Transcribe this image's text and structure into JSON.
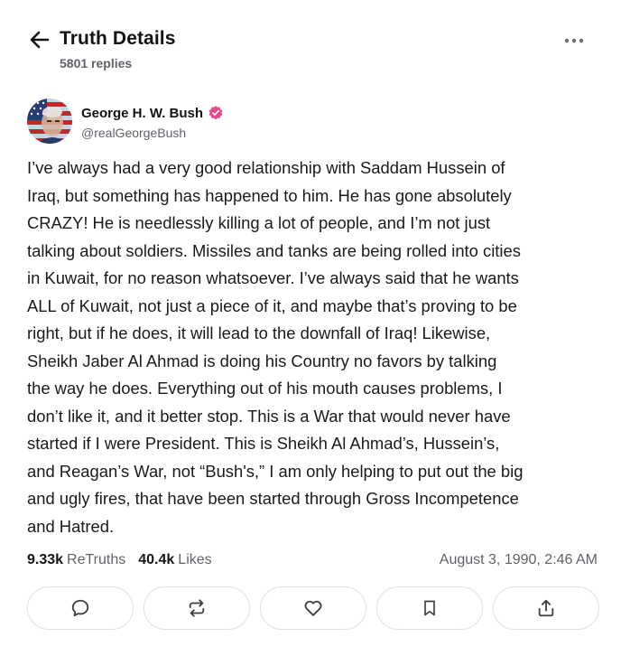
{
  "header": {
    "title": "Truth Details",
    "reply_count": "5801 replies",
    "back_icon": "arrow-left-icon",
    "more_icon": "more-horizontal-icon"
  },
  "author": {
    "display_name": "George H. W. Bush",
    "handle": "@realGeorgeBush",
    "verified_color": "#e9488f"
  },
  "post": {
    "lines": [
      "I’ve always had a very good relationship with Saddam Hussein of",
      "Iraq, but something has happened to him. He has gone absolutely",
      "CRAZY! He is needlessly killing a lot of people, and I’m not just",
      "talking about soldiers. Missiles and tanks are being rolled into cities",
      "in Kuwait, for no reason whatsoever. I’ve always said that he wants",
      "ALL of Kuwait, not just a piece of it, and maybe that’s proving to be",
      "right, but if he does, it will lead to the downfall of Iraq! Likewise,",
      "Sheikh Jaber Al Ahmad is doing his Country no favors by talking",
      "the way he does. Everything out of his mouth causes problems, I",
      "don’t like it, and it better stop. This is a War that would never have",
      "started if I were President. This is Sheikh Al Ahmad’s, Hussein’s,",
      "and Reagan’s War, not “Bush's,” I am only helping to put out the big",
      "and ugly fires, that have been started through Gross Incompetence",
      "and Hatred."
    ]
  },
  "stats": {
    "retruths_count": "9.33k",
    "retruths_label": "ReTruths",
    "likes_count": "40.4k",
    "likes_label": "Likes",
    "timestamp": "August 3, 1990, 2:46 AM"
  },
  "actions": [
    {
      "name": "reply-button",
      "icon": "speech-bubble-icon"
    },
    {
      "name": "retruth-button",
      "icon": "repost-icon"
    },
    {
      "name": "like-button",
      "icon": "heart-icon"
    },
    {
      "name": "bookmark-button",
      "icon": "bookmark-icon"
    },
    {
      "name": "share-button",
      "icon": "share-icon"
    }
  ],
  "colors": {
    "text_primary": "#141414",
    "text_secondary": "#5f6368",
    "border": "#dfe1e5",
    "verified": "#e9488f"
  }
}
